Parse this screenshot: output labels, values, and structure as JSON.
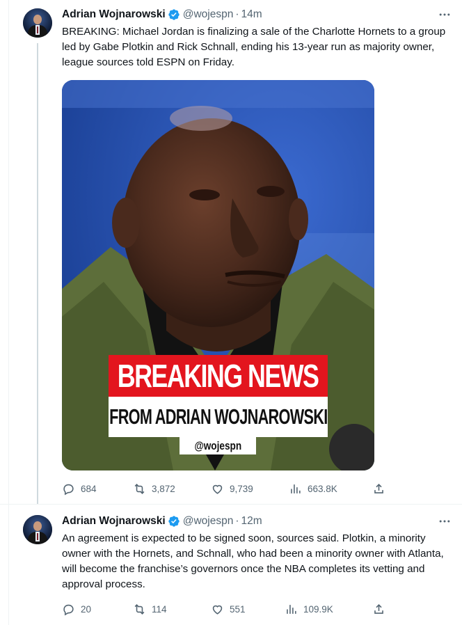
{
  "tweets": [
    {
      "author": {
        "name": "Adrian Wojnarowski",
        "handle": "@wojespn",
        "verified": true
      },
      "time": "14m",
      "text": "BREAKING: Michael Jordan is finalizing a sale of the Charlotte Hornets to a group led by Gabe Plotkin and Rick Schnall, ending his 13-year run as majority owner, league sources told ESPN on Friday.",
      "media": {
        "headline": "BREAKING NEWS",
        "subheadline": "FROM ADRIAN WOJNAROWSKI",
        "handle": "@wojespn"
      },
      "metrics": {
        "replies": "684",
        "retweets": "3,872",
        "likes": "9,739",
        "views": "663.8K"
      }
    },
    {
      "author": {
        "name": "Adrian Wojnarowski",
        "handle": "@wojespn",
        "verified": true
      },
      "time": "12m",
      "text": "An agreement is expected to be signed soon, sources said. Plotkin, a minority owner with the Hornets, and Schnall, who had been a minority owner with Atlanta, will become the franchise’s governors once the NBA completes its vetting and approval process.",
      "metrics": {
        "replies": "20",
        "retweets": "114",
        "likes": "551",
        "views": "109.9K"
      }
    }
  ],
  "colors": {
    "verified": "#1d9bf0",
    "secondary_text": "#536471",
    "banner_red": "#e3151e",
    "thread_line": "#cfd9de"
  },
  "icons": [
    "verified-badge-icon",
    "more-icon",
    "reply-icon",
    "retweet-icon",
    "like-icon",
    "views-icon",
    "share-icon"
  ]
}
